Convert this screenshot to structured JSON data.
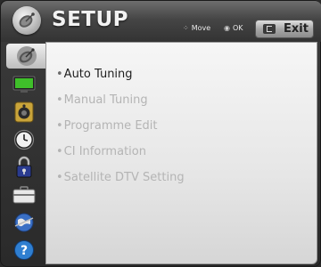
{
  "header": {
    "title": "SETUP",
    "icon": "satellite-dish-icon",
    "hints": [
      {
        "glyph": "⁘",
        "label": "Move"
      },
      {
        "glyph": "◉",
        "label": "OK"
      }
    ],
    "exit_label": "Exit"
  },
  "sidebar": {
    "items": [
      {
        "icon": "satellite-dish-icon",
        "active": true
      },
      {
        "icon": "tv-screen-icon",
        "active": false
      },
      {
        "icon": "speaker-icon",
        "active": false
      },
      {
        "icon": "clock-icon",
        "active": false
      },
      {
        "icon": "lock-icon",
        "active": false
      },
      {
        "icon": "briefcase-icon",
        "active": false
      },
      {
        "icon": "network-globe-icon",
        "active": false
      },
      {
        "icon": "help-icon",
        "active": false
      }
    ]
  },
  "menu": {
    "items": [
      {
        "label": "Auto Tuning",
        "selected": true
      },
      {
        "label": "Manual Tuning",
        "selected": false
      },
      {
        "label": "Programme Edit",
        "selected": false
      },
      {
        "label": "CI Information",
        "selected": false
      },
      {
        "label": "Satellite DTV Setting",
        "selected": false
      }
    ],
    "bullet": "•"
  },
  "colors": {
    "selected_text": "#1e1e1e",
    "inactive_text": "#b4b4b4",
    "panel_bg": "#eeeeee",
    "header_bg": "#3c3c3c"
  }
}
